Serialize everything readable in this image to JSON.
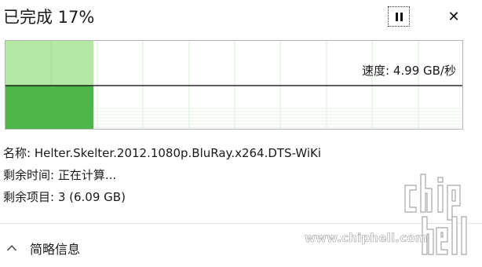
{
  "header": {
    "title": "已完成 17%",
    "pause_icon": "pause-icon",
    "close_icon": "close-icon",
    "close_glyph": "✕"
  },
  "graph": {
    "progress": 0.17,
    "speed_label": "速度: 4.99 GB/秒",
    "colors": {
      "fill_dark": "#4cb648",
      "fill_light": "#b4e6a4",
      "grid": "#d8ecd6",
      "speed_line": "#000000"
    }
  },
  "info": {
    "name": "名称: Helter.Skelter.2012.1080p.BluRay.x264.DTS-WiKi",
    "time_remaining": "剩余时间: 正在计算...",
    "items_remaining": "剩余项目: 3 (6.09 GB)"
  },
  "details": {
    "label": "简略信息",
    "icon": "chevron-up-icon"
  },
  "watermark": {
    "url": "www.chiphell.com",
    "logo_text": "chip hell"
  }
}
